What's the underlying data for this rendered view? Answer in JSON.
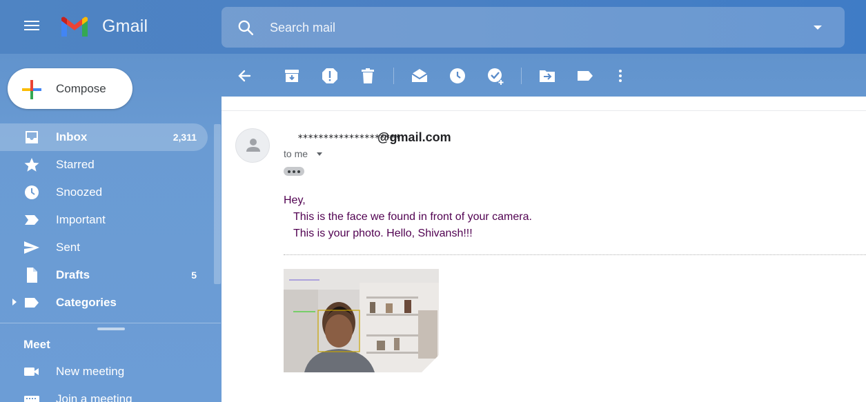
{
  "app": {
    "logo_text": "Gmail"
  },
  "search": {
    "placeholder": "Search mail"
  },
  "compose": {
    "label": "Compose"
  },
  "sidebar": {
    "items": [
      {
        "label": "Inbox",
        "count": "2,311",
        "icon": "inbox-icon"
      },
      {
        "label": "Starred",
        "count": "",
        "icon": "star-icon"
      },
      {
        "label": "Snoozed",
        "count": "",
        "icon": "clock-icon"
      },
      {
        "label": "Important",
        "count": "",
        "icon": "important-icon"
      },
      {
        "label": "Sent",
        "count": "",
        "icon": "send-icon"
      },
      {
        "label": "Drafts",
        "count": "5",
        "icon": "draft-icon"
      },
      {
        "label": "Categories",
        "count": "",
        "icon": "label-icon"
      }
    ]
  },
  "meet": {
    "title": "Meet",
    "items": [
      {
        "label": "New meeting",
        "icon": "video-icon"
      },
      {
        "label": "Join a meeting",
        "icon": "keyboard-icon"
      }
    ]
  },
  "toolbar": {
    "icons": [
      "back-arrow-icon",
      "archive-icon",
      "report-spam-icon",
      "delete-icon",
      "mark-unread-icon",
      "snooze-icon",
      "add-task-icon",
      "move-to-icon",
      "labels-icon",
      "more-vert-icon"
    ]
  },
  "email": {
    "sender_masked": "********************",
    "sender_domain": "@gmail.com",
    "recipient": "to me",
    "greeting": "Hey,",
    "body_line1": "This is the face we found in front of your camera.",
    "body_line2": "This is your photo. Hello, Shivansh!!!"
  },
  "colors": {
    "accent": "#4f84c3",
    "body_text": "#500050"
  }
}
